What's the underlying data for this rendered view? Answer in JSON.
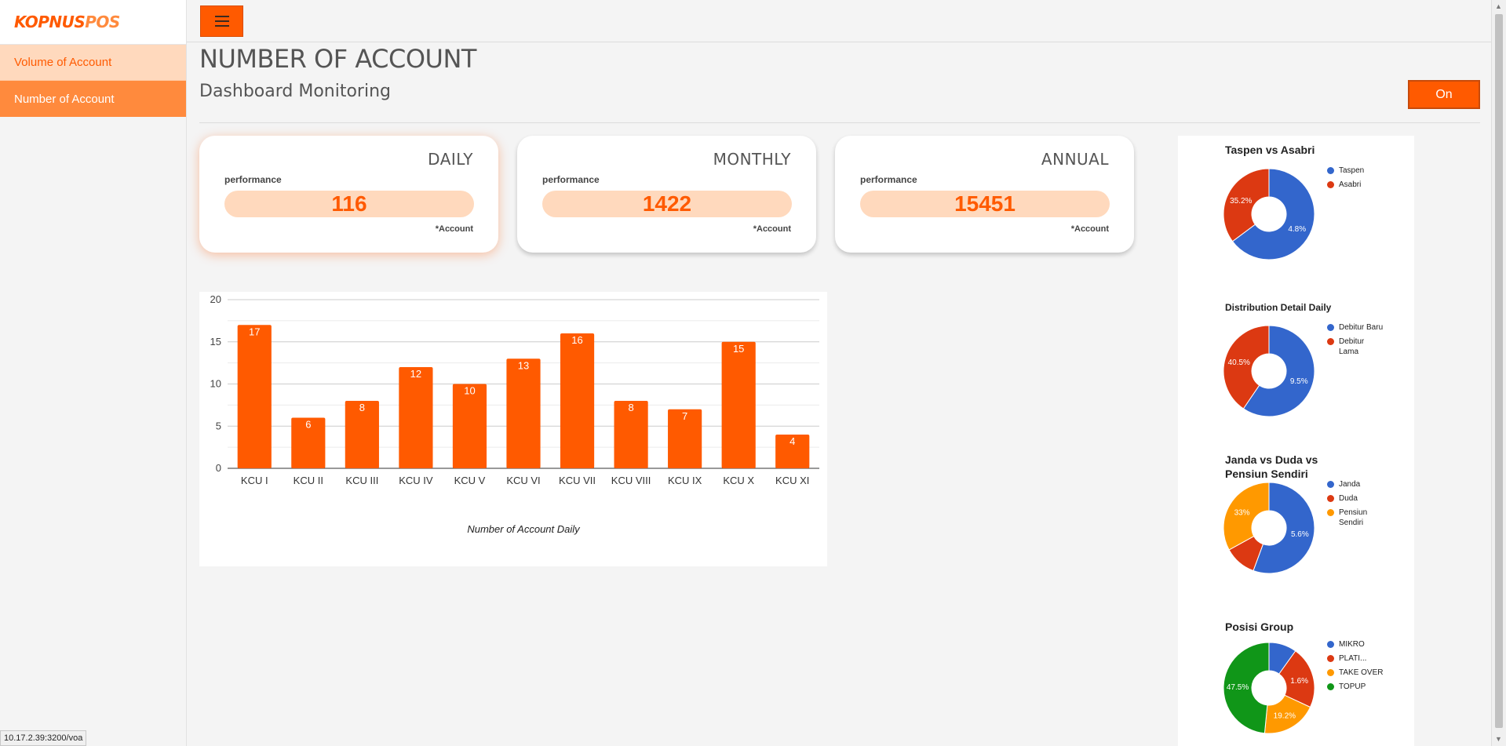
{
  "brand": {
    "logo_part1": "KOPNUS",
    "logo_part2": "POS"
  },
  "sidebar": {
    "items": [
      {
        "label": "Volume of Account"
      },
      {
        "label": "Number of Account"
      }
    ]
  },
  "header": {
    "title": "NUMBER OF ACCOUNT",
    "subtitle": "Dashboard Monitoring",
    "toggle_label": "On"
  },
  "cards": [
    {
      "title": "DAILY",
      "perf_label": "performance",
      "value": "116",
      "unit": "*Account"
    },
    {
      "title": "MONTHLY",
      "perf_label": "performance",
      "value": "1422",
      "unit": "*Account"
    },
    {
      "title": "ANNUAL",
      "perf_label": "performance",
      "value": "15451",
      "unit": "*Account"
    }
  ],
  "colors": {
    "accent": "#ff5a00",
    "accent_light": "#ffd9bd",
    "blue": "#3366cc",
    "red": "#dc3912",
    "orange": "#ff9900",
    "green": "#109618"
  },
  "chart_data": [
    {
      "type": "bar",
      "title": "",
      "xlabel": "Number of Account Daily",
      "ylabel": "",
      "categories": [
        "KCU I",
        "KCU II",
        "KCU III",
        "KCU IV",
        "KCU V",
        "KCU VI",
        "KCU VII",
        "KCU VIII",
        "KCU IX",
        "KCU X",
        "KCU XI"
      ],
      "values": [
        17,
        6,
        8,
        12,
        10,
        13,
        16,
        8,
        7,
        15,
        4
      ],
      "ylim": [
        0,
        20
      ],
      "yticks": [
        0,
        5,
        10,
        15,
        20
      ],
      "grid": true,
      "color": "#ff5a00"
    },
    {
      "type": "pie",
      "title": "Taspen vs Asabri",
      "labels": [
        "Taspen",
        "Asabri"
      ],
      "values": [
        64.8,
        35.2
      ],
      "value_labels": [
        "4.8%",
        "35.2%"
      ],
      "colors": [
        "#3366cc",
        "#dc3912"
      ],
      "legend": "right"
    },
    {
      "type": "pie",
      "title": "Distribution Detail Daily",
      "labels": [
        "Debitur Baru",
        "Debitur Lama"
      ],
      "values": [
        59.5,
        40.5
      ],
      "value_labels": [
        "9.5%",
        "40.5%"
      ],
      "colors": [
        "#3366cc",
        "#dc3912"
      ],
      "legend": "right"
    },
    {
      "type": "pie",
      "title": "Janda vs Duda vs Pensiun Sendiri",
      "labels": [
        "Janda",
        "Duda",
        "Pensiun Sendiri"
      ],
      "values": [
        55.6,
        11.4,
        33
      ],
      "value_labels": [
        "5.6%",
        "",
        "33%"
      ],
      "colors": [
        "#3366cc",
        "#dc3912",
        "#ff9900"
      ],
      "legend": "right"
    },
    {
      "type": "pie",
      "title": "Posisi Group",
      "labels": [
        "MIKRO",
        "PLATI...",
        "TAKE OVER",
        "TOPUP"
      ],
      "values": [
        9.7,
        21.6,
        19.2,
        47.5
      ],
      "value_labels": [
        "",
        "1.6%",
        "19.2%",
        "47.5%"
      ],
      "colors": [
        "#3366cc",
        "#dc3912",
        "#ff9900",
        "#109618"
      ],
      "legend": "right"
    }
  ],
  "status_bar": {
    "url": "10.17.2.39:3200/voa"
  }
}
